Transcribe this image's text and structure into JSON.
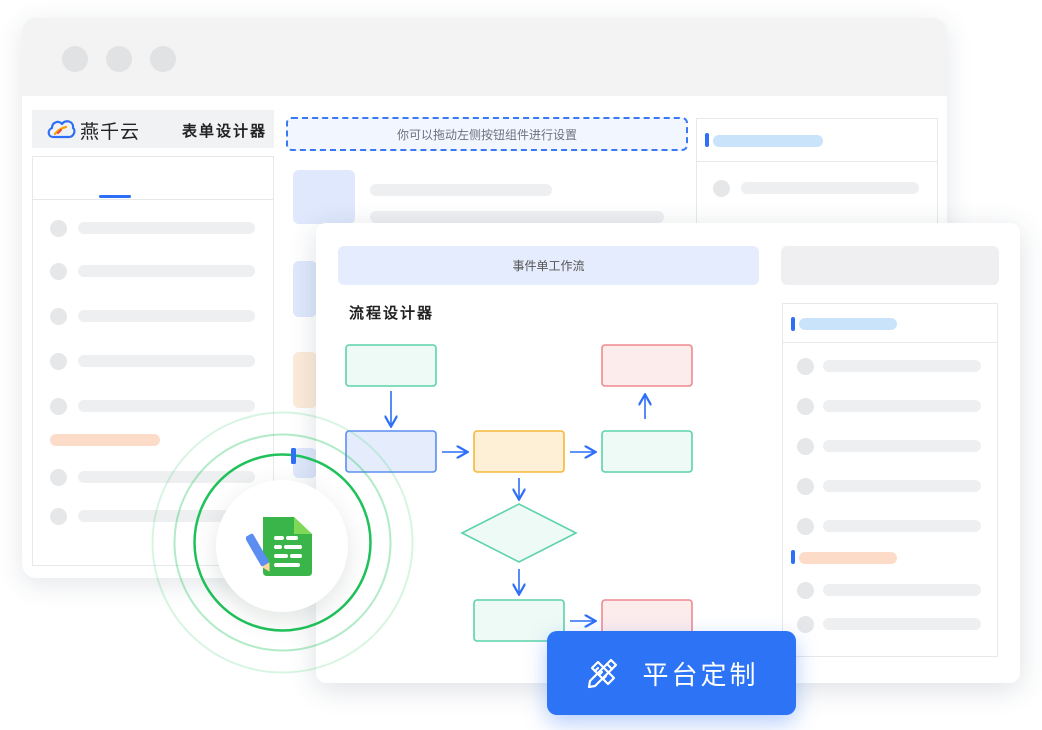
{
  "app": {
    "brand": "燕千云",
    "title": "表单设计器"
  },
  "form_designer": {
    "hint": "你可以拖动左侧按钮组件进行设置"
  },
  "workflow_window": {
    "bar_label": "事件单工作流",
    "section_title": "流程设计器"
  },
  "cta": {
    "label": "平台定制"
  },
  "icons": {
    "logo": "cloud-logo-icon",
    "form": "form-document-icon",
    "customize": "pencil-ruler-icon"
  },
  "colors": {
    "accent": "#2d73f5",
    "node_green": "#5cd3a8",
    "node_blue": "#5b8ef0",
    "node_yellow": "#f5b83a",
    "node_red": "#ef8a8e",
    "ring_green": "#22c55e",
    "placeholder_orange": "#fcdcc9",
    "placeholder_blue": "#c9e3fb"
  }
}
